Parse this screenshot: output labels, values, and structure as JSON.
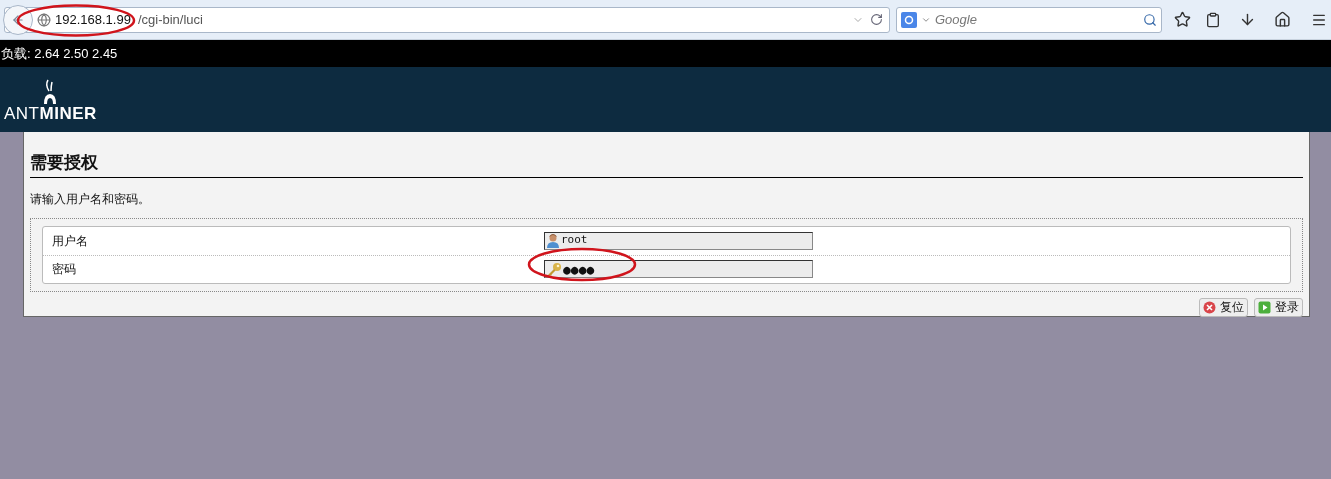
{
  "browser": {
    "url_host": "192.168.1.99",
    "url_path": "/cgi-bin/luci",
    "search_placeholder": "Google"
  },
  "load_bar": {
    "text": "负载: 2.64 2.50 2.45"
  },
  "header": {
    "logo_light": "ANT",
    "logo_bold": "MINER"
  },
  "login": {
    "title": "需要授权",
    "description": "请输入用户名和密码。",
    "fields": [
      {
        "kind": "user",
        "label": "用户名",
        "value": "root"
      },
      {
        "kind": "password",
        "label": "密码",
        "value": "●●●●"
      }
    ],
    "buttons": [
      {
        "kind": "reset",
        "label": "复位"
      },
      {
        "kind": "submit",
        "label": "登录"
      }
    ]
  }
}
